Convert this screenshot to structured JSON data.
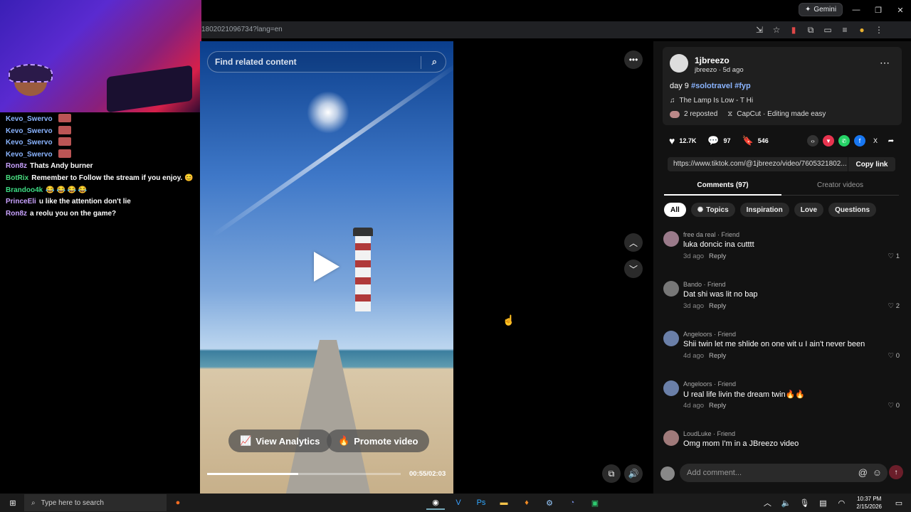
{
  "browser": {
    "url": "1802021096734?lang=en",
    "gemini_label": "Gemini"
  },
  "chat": [
    {
      "user": "Kevo_Swervo",
      "color": "#8ab4ff",
      "text": "",
      "emotes": 1
    },
    {
      "user": "Kevo_Swervo",
      "color": "#8ab4ff",
      "text": "",
      "emotes": 1
    },
    {
      "user": "Kevo_Swervo",
      "color": "#8ab4ff",
      "text": "",
      "emotes": 1
    },
    {
      "user": "Kevo_Swervo",
      "color": "#8ab4ff",
      "text": "",
      "emotes": 1
    },
    {
      "user": "Ron8z",
      "color": "#c9a2ff",
      "text": "Thats Andy burner",
      "emotes": 0
    },
    {
      "user": "BotRix",
      "color": "#4ade80",
      "text": "Remember to Follow the stream if you enjoy. 😊",
      "emotes": 0
    },
    {
      "user": "Brandoo4k",
      "color": "#3ddc84",
      "text": "😂 😂 😂 😂",
      "emotes": 0
    },
    {
      "user": "PrinceEli",
      "color": "#c9a2ff",
      "text": "u like the attention don't lie",
      "emotes": 0
    },
    {
      "user": "Ron8z",
      "color": "#c9a2ff",
      "text": "a reolu you on the game?",
      "emotes": 0
    }
  ],
  "video": {
    "search_placeholder": "Find related content",
    "view_analytics": "View Analytics",
    "promote_video": "Promote video",
    "time": "00:55/02:03",
    "progress": 0.47
  },
  "post": {
    "username": "1jbreezo",
    "subline": "jbreezo · 5d ago",
    "caption_prefix": "day 9",
    "hashtags": "#solotravel #fyp",
    "music": "The Lamp Is Low - T Hi",
    "reposted": "2 reposted",
    "capcut": "CapCut · Editing made easy",
    "likes": "12.7K",
    "comments_count": "97",
    "saves": "546",
    "link": "https://www.tiktok.com/@1jbreezo/video/7605321802...",
    "copy_link": "Copy link"
  },
  "tabs": {
    "comments": "Comments (97)",
    "creator_videos": "Creator videos"
  },
  "filters": [
    "All",
    "Topics",
    "Inspiration",
    "Love",
    "Questions"
  ],
  "comments": [
    {
      "name": "free da real · Friend",
      "text": "luka doncic ina cutttt",
      "time": "3d ago",
      "reply": "Reply",
      "likes": "1"
    },
    {
      "name": "Bando · Friend",
      "text": "Dat shi was lit no bap",
      "time": "3d ago",
      "reply": "Reply",
      "likes": "2"
    },
    {
      "name": "Angeloors · Friend",
      "text": "Shii twin let me shlide on one wit u I ain't never been",
      "time": "4d ago",
      "reply": "Reply",
      "likes": "0"
    },
    {
      "name": "Angeloors · Friend",
      "text": "U real life livin the dream twin🔥🔥",
      "time": "4d ago",
      "reply": "Reply",
      "likes": "0"
    },
    {
      "name": "LoudLuke · Friend",
      "text": "Omg mom I'm in a JBreezo video",
      "time": "",
      "reply": "",
      "likes": ""
    }
  ],
  "add_comment_placeholder": "Add comment...",
  "taskbar": {
    "search_placeholder": "Type here to search",
    "time": "10:37 PM",
    "date": "2/15/2026"
  }
}
